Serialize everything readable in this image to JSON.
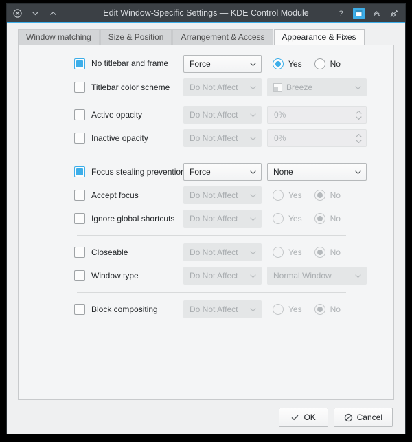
{
  "window": {
    "title": "Edit Window-Specific Settings — KDE Control Module",
    "titlebar_buttons_left": [
      {
        "name": "close-icon",
        "label": "Close"
      },
      {
        "name": "chevron-down-icon",
        "label": "Minimize"
      },
      {
        "name": "chevron-up-icon",
        "label": "Maximize"
      }
    ],
    "titlebar_buttons_right": [
      {
        "name": "help-icon",
        "label": "?"
      },
      {
        "name": "keep-below-icon",
        "label": "Keep Below"
      },
      {
        "name": "shade-icon",
        "label": "Shade"
      },
      {
        "name": "pin-icon",
        "label": "Keep Above"
      }
    ]
  },
  "tabs": [
    {
      "label": "Window matching",
      "selected": false
    },
    {
      "label": "Size & Position",
      "selected": false
    },
    {
      "label": "Arrangement & Access",
      "selected": false
    },
    {
      "label": "Appearance & Fixes",
      "selected": true
    }
  ],
  "rows": {
    "no_titlebar": {
      "label": "No titlebar and frame",
      "checked": true,
      "affect": "Force",
      "radio_yes": "Yes",
      "radio_no": "No",
      "selected": "Yes"
    },
    "titlebar_color": {
      "label": "Titlebar color scheme",
      "checked": false,
      "affect": "Do Not Affect",
      "value": "Breeze"
    },
    "active_opacity": {
      "label": "Active opacity",
      "checked": false,
      "affect": "Do Not Affect",
      "value": "0%"
    },
    "inactive_opacity": {
      "label": "Inactive opacity",
      "checked": false,
      "affect": "Do Not Affect",
      "value": "0%"
    },
    "focus_stealing": {
      "label": "Focus stealing prevention",
      "checked": true,
      "affect": "Force",
      "value": "None"
    },
    "accept_focus": {
      "label": "Accept focus",
      "checked": false,
      "affect": "Do Not Affect",
      "radio_yes": "Yes",
      "radio_no": "No",
      "selected": "No"
    },
    "ignore_shortcuts": {
      "label": "Ignore global shortcuts",
      "checked": false,
      "affect": "Do Not Affect",
      "radio_yes": "Yes",
      "radio_no": "No",
      "selected": "No"
    },
    "closeable": {
      "label": "Closeable",
      "checked": false,
      "affect": "Do Not Affect",
      "radio_yes": "Yes",
      "radio_no": "No",
      "selected": "No"
    },
    "window_type": {
      "label": "Window type",
      "checked": false,
      "affect": "Do Not Affect",
      "value": "Normal Window"
    },
    "block_compositing": {
      "label": "Block compositing",
      "checked": false,
      "affect": "Do Not Affect",
      "radio_yes": "Yes",
      "radio_no": "No",
      "selected": "No"
    }
  },
  "footer": {
    "ok_label": "OK",
    "cancel_label": "Cancel"
  },
  "colors": {
    "accent": "#3daee9",
    "titlebar_bg": "#3b4045",
    "window_bg": "#eff0f1",
    "panel_bg": "#f4f5f6"
  }
}
